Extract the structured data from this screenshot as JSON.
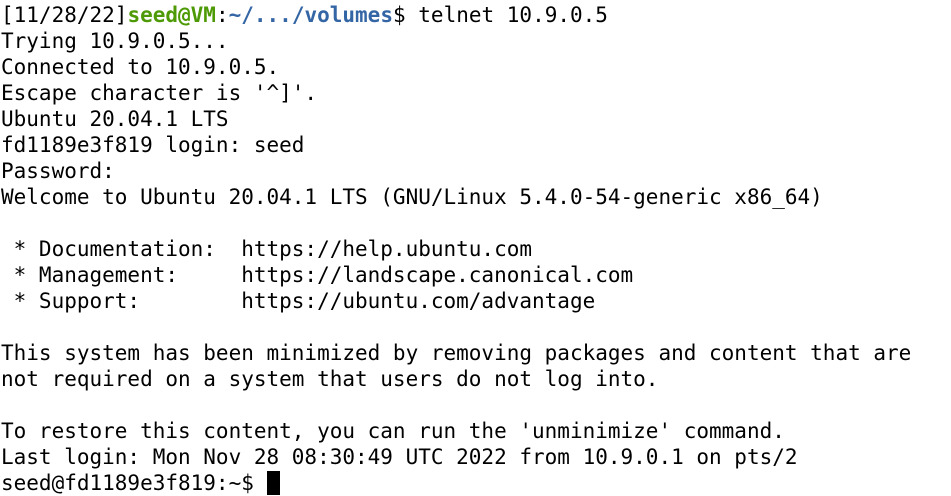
{
  "prompt1": {
    "date": "[11/28/22]",
    "user_host": "seed@VM",
    "sep": ":",
    "path": "~/.../volumes",
    "sym": "$ ",
    "command": "telnet 10.9.0.5"
  },
  "lines": [
    "Trying 10.9.0.5...",
    "Connected to 10.9.0.5.",
    "Escape character is '^]'.",
    "Ubuntu 20.04.1 LTS",
    "fd1189e3f819 login: seed",
    "Password:",
    "Welcome to Ubuntu 20.04.1 LTS (GNU/Linux 5.4.0-54-generic x86_64)",
    "",
    " * Documentation:  https://help.ubuntu.com",
    " * Management:     https://landscape.canonical.com",
    " * Support:        https://ubuntu.com/advantage",
    "",
    "This system has been minimized by removing packages and content that are",
    "not required on a system that users do not log into.",
    "",
    "To restore this content, you can run the 'unminimize' command.",
    "Last login: Mon Nov 28 08:30:49 UTC 2022 from 10.9.0.1 on pts/2"
  ],
  "prompt2": "seed@fd1189e3f819:~$ ",
  "colors": {
    "user": "#4e9a06",
    "path": "#3465a4",
    "text": "#000000",
    "background": "#ffffff"
  }
}
